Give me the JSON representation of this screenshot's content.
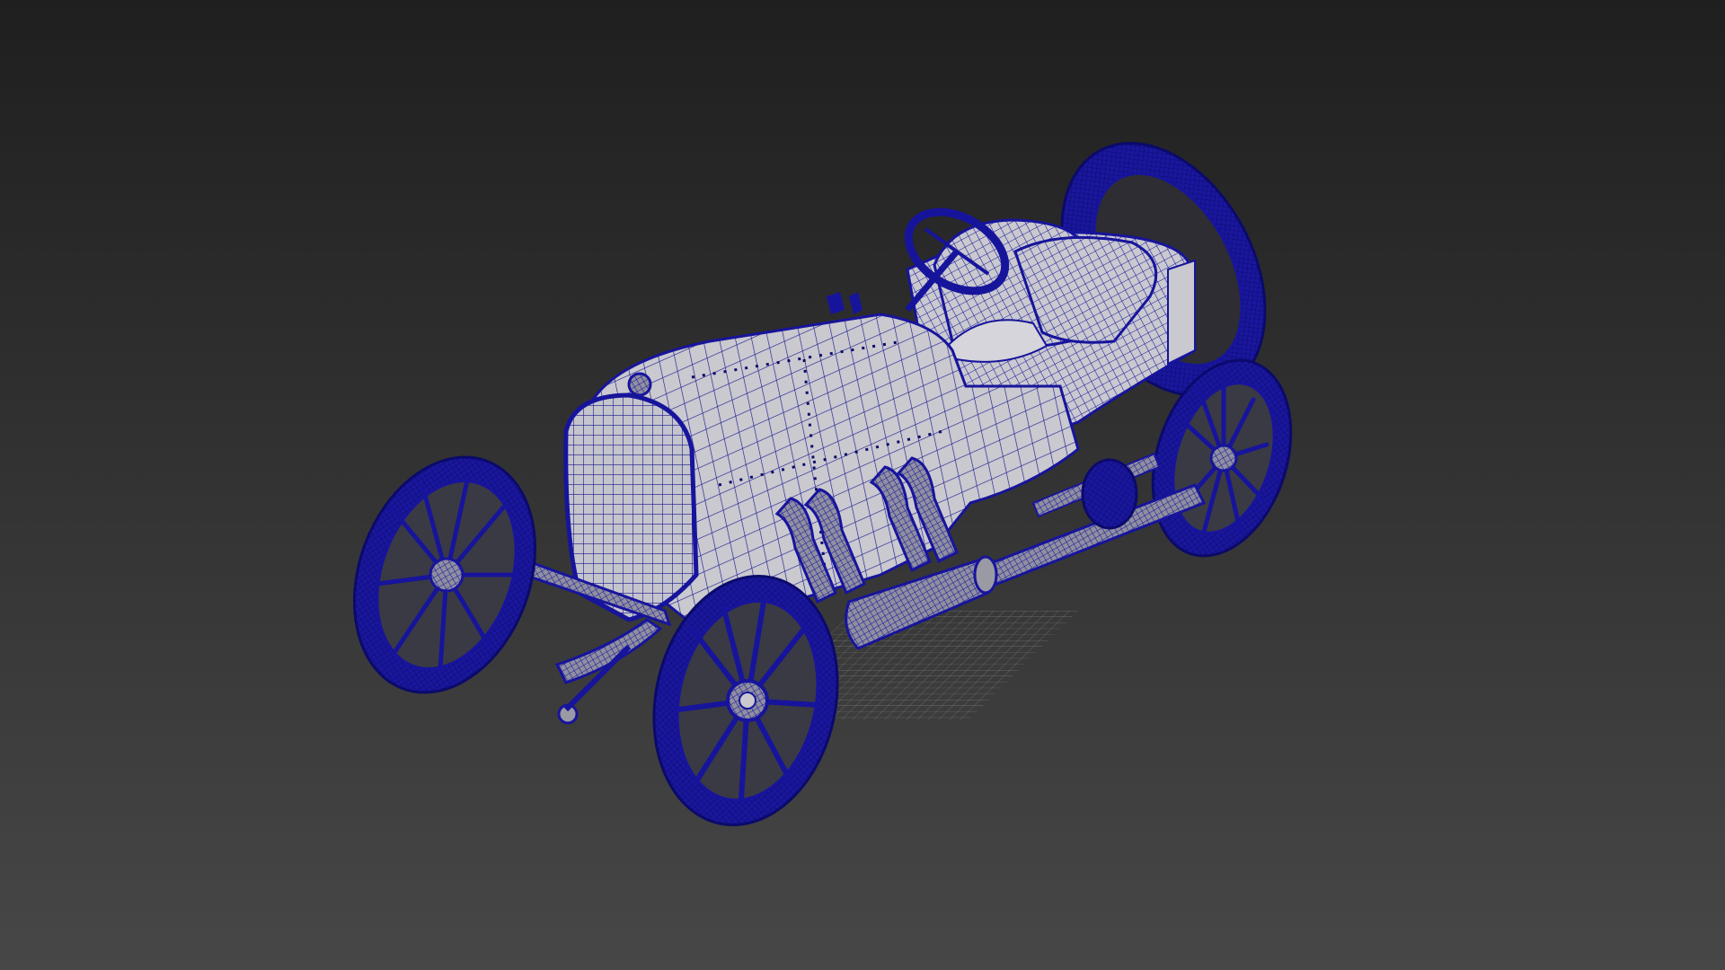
{
  "viewport": {
    "background_top": "#1f1f1f",
    "background_bottom": "#474747",
    "wire_color": "#17149c",
    "wire_dark": "#0b0a6a",
    "surface_color": "#c9c9cf",
    "surface_shadow": "#9a9aa4",
    "grid_color": "#8a8a8a"
  },
  "scene": {
    "object": "wireframe-vintage-race-car",
    "render_mode": "wireframe-on-shaded"
  }
}
